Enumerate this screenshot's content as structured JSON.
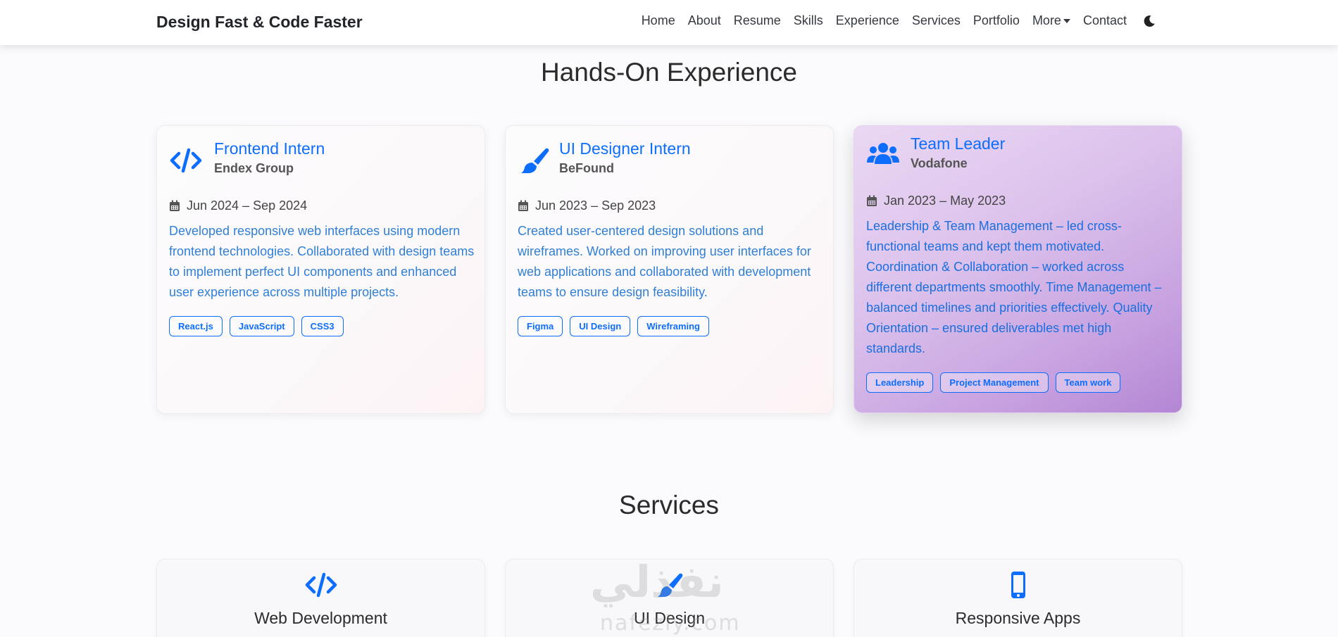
{
  "navbar": {
    "brand": "Design Fast & Code Faster",
    "links": [
      "Home",
      "About",
      "Resume",
      "Skills",
      "Experience",
      "Services",
      "Portfolio",
      "More",
      "Contact"
    ],
    "theme_toggle_icon": "moon-icon"
  },
  "experience": {
    "title": "Hands-On Experience",
    "cards": [
      {
        "icon": "code-icon",
        "title": "Frontend Intern",
        "company": "Endex Group",
        "date": "Jun 2024 – Sep 2024",
        "description": "Developed responsive web interfaces using modern frontend technologies. Collaborated with design teams to implement perfect UI components and enhanced user experience across multiple projects.",
        "tags": [
          "React.js",
          "JavaScript",
          "CSS3"
        ]
      },
      {
        "icon": "paintbrush-icon",
        "title": "UI Designer Intern",
        "company": "BeFound",
        "date": "Jun 2023 – Sep 2023",
        "description": "Created user-centered design solutions and wireframes. Worked on improving user interfaces for web applications and collaborated with development teams to ensure design feasibility.",
        "tags": [
          "Figma",
          "UI Design",
          "Wireframing"
        ]
      },
      {
        "icon": "users-icon",
        "title": "Team Leader",
        "company": "Vodafone",
        "date": "Jan 2023 – May 2023",
        "description": "Leadership & Team Management – led cross-functional teams and kept them motivated. Coordination & Collaboration – worked across different departments smoothly. Time Management – balanced timelines and priorities effectively. Quality Orientation – ensured deliverables met high standards.",
        "tags": [
          "Leadership",
          "Project Management",
          "Team work"
        ]
      }
    ]
  },
  "services": {
    "title": "Services",
    "items": [
      {
        "icon": "code-icon",
        "title": "Web Development"
      },
      {
        "icon": "paintbrush-icon",
        "title": "UI Design"
      },
      {
        "icon": "mobile-icon",
        "title": "Responsive Apps"
      }
    ]
  },
  "watermark": {
    "arabic": "نفذلي",
    "latin": "nafezly.com"
  },
  "colors": {
    "accent": "#0d6efd",
    "active_card": "#c7a2e0"
  }
}
